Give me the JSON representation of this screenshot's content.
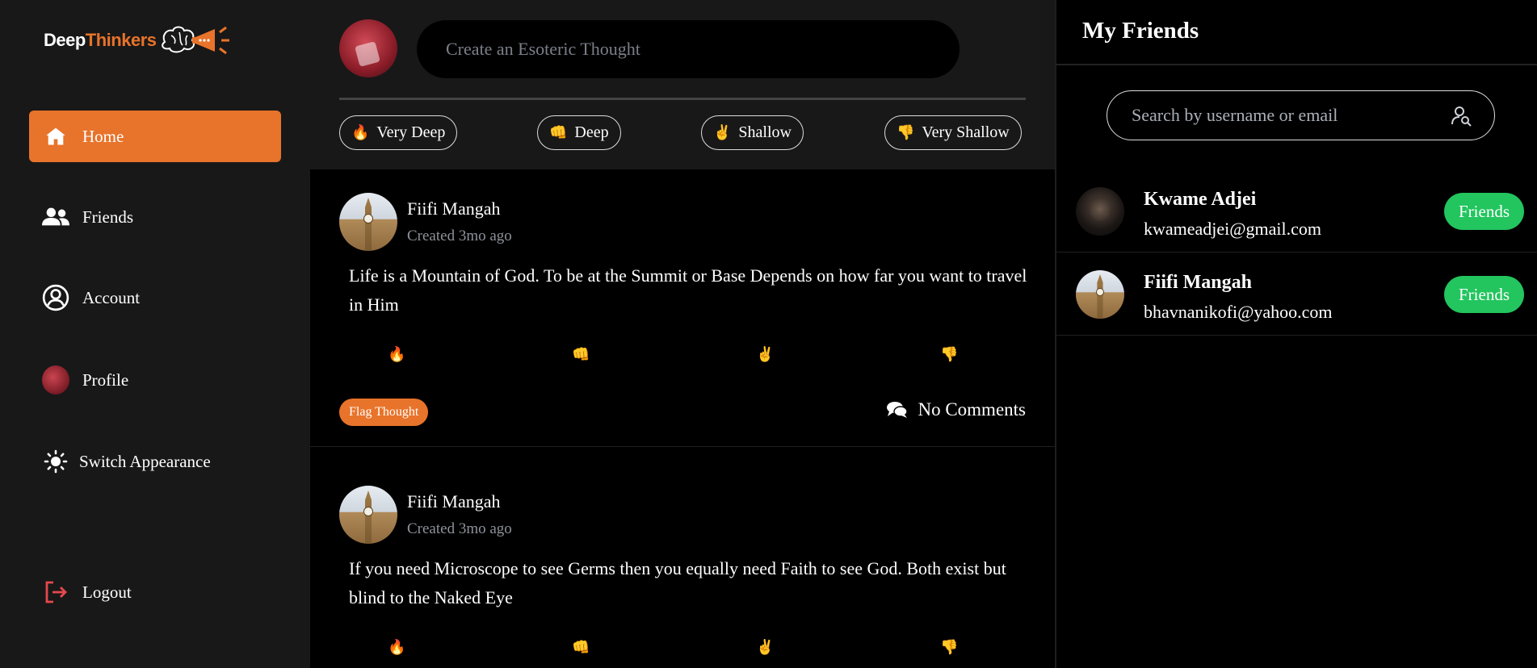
{
  "brand": {
    "logo_part1": "Deep",
    "logo_part2": "Thinkers",
    "accent": "#e8732a"
  },
  "sidebar": {
    "items": [
      {
        "label": "Home",
        "icon": "home-icon",
        "active": true
      },
      {
        "label": "Friends",
        "icon": "users-icon"
      },
      {
        "label": "Account",
        "icon": "user-circle-icon"
      },
      {
        "label": "Profile",
        "icon": "avatar"
      },
      {
        "label": "Switch Appearance",
        "icon": "sun-icon"
      }
    ],
    "logout": {
      "label": "Logout",
      "icon": "logout-icon",
      "color": "#e5484d"
    }
  },
  "composer": {
    "placeholder": "Create an Esoteric Thought",
    "depth_buttons": [
      {
        "emoji": "🔥",
        "label": "Very Deep"
      },
      {
        "emoji": "👊",
        "label": "Deep"
      },
      {
        "emoji": "✌️",
        "label": "Shallow"
      },
      {
        "emoji": "👎",
        "label": "Very Shallow"
      }
    ]
  },
  "posts": [
    {
      "author": "Fiifi Mangah",
      "time": "Created 3mo ago",
      "text": "Life is a Mountain of God. To be at the Summit or Base Depends on how far you want to travel in Him",
      "reactions": [
        "🔥",
        "👊",
        "✌️",
        "👎"
      ],
      "flag_label": "Flag Thought",
      "comments_label": "No Comments"
    },
    {
      "author": "Fiifi Mangah",
      "time": "Created 3mo ago",
      "text": "If you need Microscope to see Germs then you equally need Faith to see God. Both exist but blind to the Naked Eye",
      "reactions": [
        "🔥",
        "👊",
        "✌️",
        "👎"
      ]
    }
  ],
  "friends_panel": {
    "title": "My Friends",
    "search_placeholder": "Search by username or email",
    "friends": [
      {
        "name": "Kwame Adjei",
        "email": "kwameadjei@gmail.com",
        "button": "Friends"
      },
      {
        "name": "Fiifi Mangah",
        "email": "bhavnanikofi@yahoo.com",
        "button": "Friends"
      }
    ],
    "button_color": "#22c55e"
  }
}
